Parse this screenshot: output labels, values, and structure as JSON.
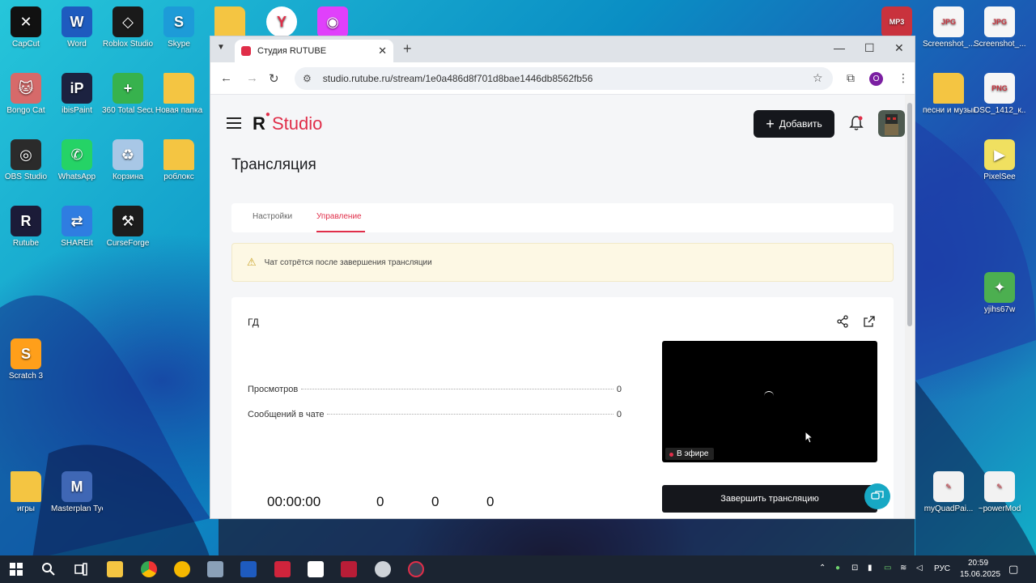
{
  "desktop": {
    "icons_left": [
      {
        "label": "CapCut",
        "icon": "capcut-icon",
        "color": "#111111",
        "glyph": "✕"
      },
      {
        "label": "Word",
        "icon": "word-icon",
        "color": "#1e5bbf",
        "glyph": "W"
      },
      {
        "label": "Roblox Studio",
        "icon": "roblox-studio-icon",
        "color": "#1a1a1a",
        "glyph": "◇"
      },
      {
        "label": "Skype",
        "icon": "skype-icon",
        "color": "#1d9bd8",
        "glyph": "S"
      },
      {
        "label": "",
        "icon": "folder-icon",
        "color": "#f4c542",
        "glyph": ""
      },
      {
        "label": "",
        "icon": "yandex-browser-icon",
        "color": "#ffffff",
        "glyph": "Y"
      },
      {
        "label": "",
        "icon": "colorful-app-icon",
        "color": "#e040fb",
        "glyph": "◉"
      },
      {
        "label": "Bongo Cat",
        "icon": "bongo-cat-icon",
        "color": "#d66a6a",
        "glyph": "🐱"
      },
      {
        "label": "ibisPaint",
        "icon": "ibispaint-icon",
        "color": "#1c2240",
        "glyph": "iP"
      },
      {
        "label": "360 Total Security",
        "icon": "security-icon",
        "color": "#37b24d",
        "glyph": "+"
      },
      {
        "label": "Новая папка",
        "icon": "folder-icon",
        "color": "#f4c542",
        "glyph": ""
      },
      {
        "label": "OBS Studio",
        "icon": "obs-icon",
        "color": "#2b2b2b",
        "glyph": "◎"
      },
      {
        "label": "WhatsApp",
        "icon": "whatsapp-icon",
        "color": "#25d366",
        "glyph": "✆"
      },
      {
        "label": "Корзина",
        "icon": "recycle-bin-icon",
        "color": "#a8c7e6",
        "glyph": "♻"
      },
      {
        "label": "роблокс",
        "icon": "folder-icon",
        "color": "#f4c542",
        "glyph": ""
      },
      {
        "label": "Rutube",
        "icon": "rutube-icon",
        "color": "#1b1b38",
        "glyph": "R"
      },
      {
        "label": "SHAREit",
        "icon": "shareit-icon",
        "color": "#2f7de1",
        "glyph": "⇄"
      },
      {
        "label": "CurseForge",
        "icon": "curseforge-icon",
        "color": "#1d1d1d",
        "glyph": "⚒"
      },
      {
        "label": "Scratch 3",
        "icon": "scratch-icon",
        "color": "#ff9f1a",
        "glyph": "S"
      },
      {
        "label": "игры",
        "icon": "folder-icon",
        "color": "#f4c542",
        "glyph": ""
      },
      {
        "label": "Masterplan Tycoon Fo...",
        "icon": "masterplan-icon",
        "color": "#3f67b5",
        "glyph": "M"
      }
    ],
    "icons_right": [
      {
        "label": "",
        "icon": "mp3-icon",
        "color": "#c9323d",
        "glyph": "MP3"
      },
      {
        "label": "Screenshot_...",
        "icon": "jpg-file-icon",
        "color": "#f6f6f6",
        "glyph": "JPG"
      },
      {
        "label": "Screenshot_...",
        "icon": "jpg-file-icon",
        "color": "#f6f6f6",
        "glyph": "JPG"
      },
      {
        "label": "песни и музыка",
        "icon": "folder-icon",
        "color": "#f4c542",
        "glyph": ""
      },
      {
        "label": "DSC_1412_к...",
        "icon": "png-file-icon",
        "color": "#f6f6f6",
        "glyph": "PNG"
      },
      {
        "label": "PixelSee",
        "icon": "pixelsee-icon",
        "color": "#f0e060",
        "glyph": "▶"
      },
      {
        "label": "yjihs67w",
        "icon": "dr-web-icon",
        "color": "#4caf50",
        "glyph": "✦"
      },
      {
        "label": "myQuadPai...",
        "icon": "quadpaint-icon",
        "color": "#f2f2f2",
        "glyph": "✎"
      },
      {
        "label": "~powerMod",
        "icon": "powermod-icon",
        "color": "#f2f2f2",
        "glyph": "✎"
      }
    ]
  },
  "browser": {
    "tab_title": "Студия RUTUBE",
    "url": "studio.rutube.ru/stream/1e0a486d8f701d8bae1446db8562fb56",
    "profile_letter": "O"
  },
  "studio": {
    "logo_r": "R",
    "logo_text": "Studio",
    "add_button": "Добавить",
    "page_title": "Трансляция",
    "tabs": [
      "Настройки",
      "Управление"
    ],
    "active_tab": "Управление",
    "warning": "Чат сотрётся после завершения трансляции",
    "stream_name": "ГД",
    "stats": [
      {
        "label": "Просмотров",
        "value": "0"
      },
      {
        "label": "Сообщений в чате",
        "value": "0"
      }
    ],
    "live_badge": "В эфире",
    "end_button": "Завершить трансляцию",
    "timer": "00:00:00",
    "counters": [
      "0",
      "0",
      "0"
    ]
  },
  "taskbar": {
    "language": "РУС",
    "time": "20:59",
    "date": "15.06.2025"
  },
  "colors": {
    "accent": "#e02e49",
    "dark_button": "#15171c",
    "help_button": "#17a8c4",
    "warning_bg": "#fdf8e4"
  }
}
